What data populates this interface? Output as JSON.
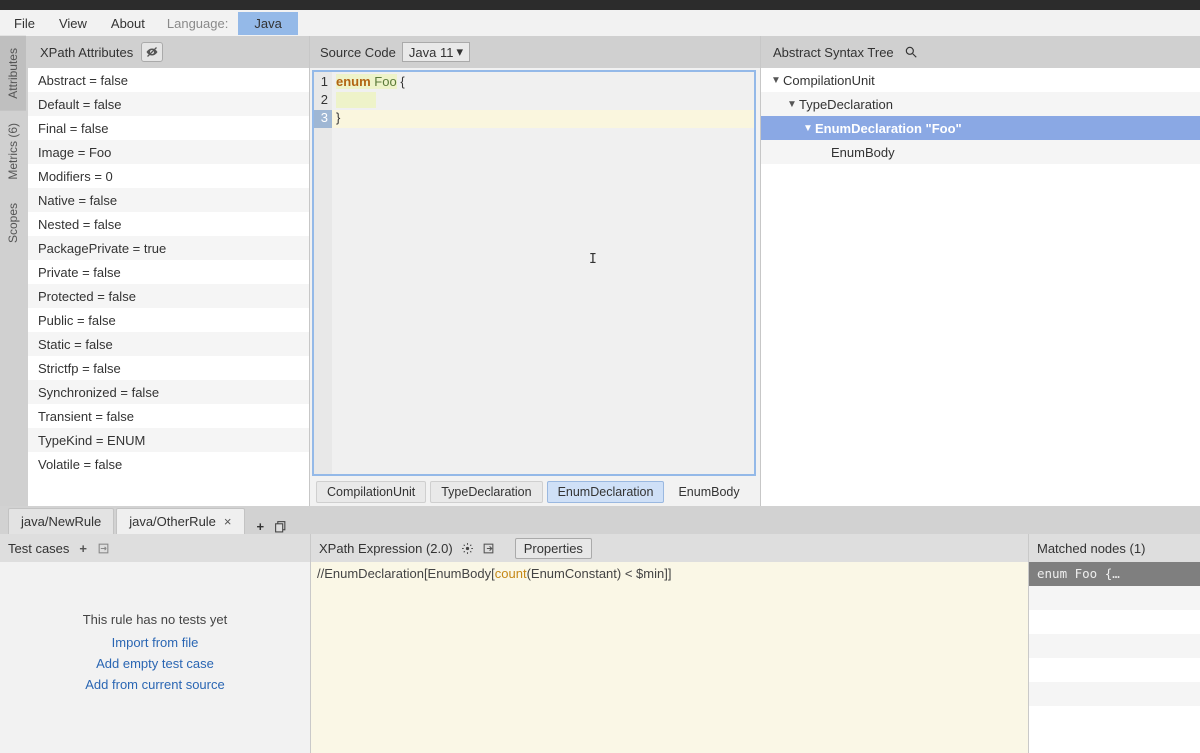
{
  "menu": {
    "file": "File",
    "view": "View",
    "about": "About",
    "lang_label": "Language:",
    "lang_value": "Java"
  },
  "sidetabs": {
    "attrs": "Attributes",
    "metrics": "Metrics   (6)",
    "scopes": "Scopes"
  },
  "attr_panel": {
    "title": "XPath Attributes"
  },
  "attributes": [
    "Abstract = false",
    "Default = false",
    "Final = false",
    "Image = Foo",
    "Modifiers = 0",
    "Native = false",
    "Nested = false",
    "PackagePrivate = true",
    "Private = false",
    "Protected = false",
    "Public = false",
    "Static = false",
    "Strictfp = false",
    "Synchronized = false",
    "Transient = false",
    "TypeKind = ENUM",
    "Volatile = false"
  ],
  "code_panel": {
    "title": "Source Code",
    "lang": "Java 11",
    "lines": {
      "l1_kw": "enum",
      "l1_id": "Foo",
      "l1_rest": " {",
      "l3": "}"
    },
    "crumbs": [
      "CompilationUnit",
      "TypeDeclaration",
      "EnumDeclaration",
      "EnumBody"
    ]
  },
  "ast_panel": {
    "title": "Abstract Syntax Tree",
    "nodes": {
      "n0": "CompilationUnit",
      "n1": "TypeDeclaration",
      "n2": "EnumDeclaration \"Foo\"",
      "n3": "EnumBody"
    }
  },
  "rules": {
    "tab1": "java/NewRule",
    "tab2": "java/OtherRule"
  },
  "tests": {
    "title": "Test cases",
    "msg": "This rule has no tests yet",
    "link1": "Import from file",
    "link2": "Add empty test case",
    "link3": "Add from current source"
  },
  "xexpr": {
    "title": "XPath Expression (2.0)",
    "props": "Properties",
    "expr_pre": "//EnumDeclaration[EnumBody[",
    "expr_fn": "count",
    "expr_post": "(EnumConstant) < $min]]"
  },
  "matched": {
    "title": "Matched nodes (1)",
    "item": "enum Foo {…"
  }
}
